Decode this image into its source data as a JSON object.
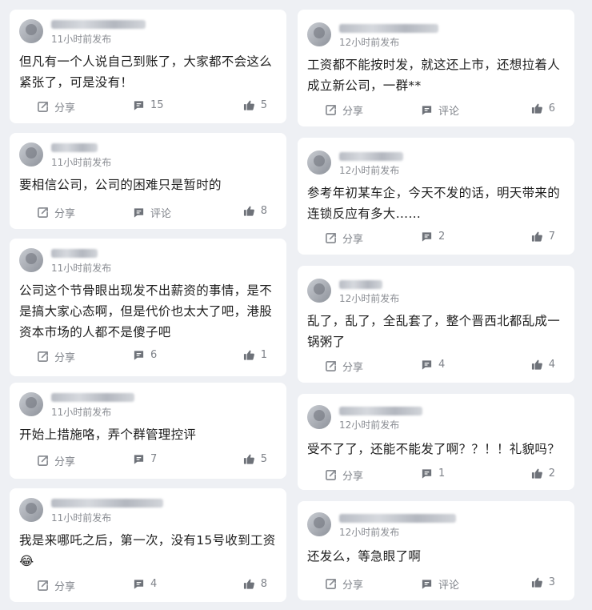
{
  "left_posts": [
    {
      "time": "11小时前发布",
      "text": "但凡有一个人说自己到账了，大家都不会这么紧张了，可是没有！",
      "share_label": "分享",
      "comment_label": "15",
      "like_count": "5"
    },
    {
      "time": "11小时前发布",
      "text": "要相信公司，公司的困难只是暂时的",
      "share_label": "分享",
      "comment_label": "评论",
      "like_count": "8"
    },
    {
      "time": "11小时前发布",
      "text": "公司这个节骨眼出现发不出薪资的事情，是不是搞大家心态啊，但是代价也太大了吧，港股资本市场的人都不是傻子吧",
      "share_label": "分享",
      "comment_label": "6",
      "like_count": "1"
    },
    {
      "time": "11小时前发布",
      "text": "开始上措施咯，弄个群管理控评",
      "share_label": "分享",
      "comment_label": "7",
      "like_count": "5"
    },
    {
      "time": "11小时前发布",
      "text": "我是来哪吒之后，第一次，没有15号收到工资😂",
      "share_label": "分享",
      "comment_label": "4",
      "like_count": "8"
    }
  ],
  "right_posts": [
    {
      "time": "12小时前发布",
      "text": "工资都不能按时发，就这还上市，还想拉着人成立新公司，一群**",
      "share_label": "分享",
      "comment_label": "评论",
      "like_count": "6"
    },
    {
      "time": "12小时前发布",
      "text": "参考年初某车企，今天不发的话，明天带来的连锁反应有多大……",
      "share_label": "分享",
      "comment_label": "2",
      "like_count": "7"
    },
    {
      "time": "12小时前发布",
      "text": "乱了，乱了，全乱套了，整个晋西北都乱成一锅粥了",
      "share_label": "分享",
      "comment_label": "4",
      "like_count": "4"
    },
    {
      "time": "12小时前发布",
      "text": "受不了了，还能不能发了啊？？！！礼貌吗？",
      "share_label": "分享",
      "comment_label": "1",
      "like_count": "2"
    },
    {
      "time": "12小时前发布",
      "text": "还发么，等急眼了啊",
      "share_label": "分享",
      "comment_label": "评论",
      "like_count": "3"
    }
  ],
  "icons": {
    "share": "share-icon",
    "comment": "comment-icon",
    "like": "thumbs-up-icon"
  },
  "colors": {
    "background": "#eef0f4",
    "card": "#ffffff",
    "meta_text": "#8a8d93",
    "action_text": "#7f838a"
  }
}
